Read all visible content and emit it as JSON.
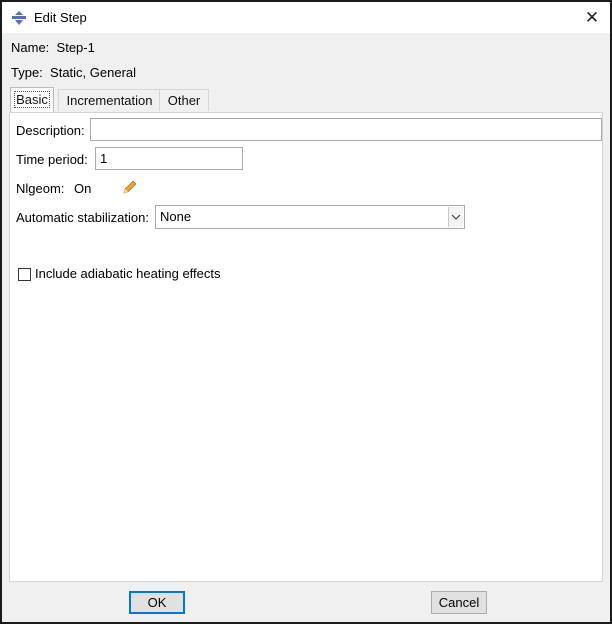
{
  "window": {
    "title": "Edit Step",
    "close_glyph": "✕"
  },
  "step": {
    "name_label": "Name:",
    "name_value": "Step-1",
    "type_label": "Type:",
    "type_value": "Static, General"
  },
  "tabs": [
    {
      "label": "Basic",
      "active": true
    },
    {
      "label": "Incrementation",
      "active": false
    },
    {
      "label": "Other",
      "active": false
    }
  ],
  "basic": {
    "description_label": "Description:",
    "description_value": "",
    "time_period_label": "Time period:",
    "time_period_value": "1",
    "nlgeom_label": "Nlgeom:",
    "nlgeom_value": "On",
    "stabilization_label": "Automatic stabilization:",
    "stabilization_value": "None",
    "adiabatic_label": "Include adiabatic heating effects",
    "adiabatic_checked": false
  },
  "buttons": {
    "ok": "OK",
    "cancel": "Cancel"
  },
  "icons": {
    "app": "abaqus-step-icon",
    "close": "close-icon",
    "edit": "pencil-icon",
    "dropdown": "chevron-down-icon"
  },
  "colors": {
    "default_button_border": "#0078d7",
    "pencil": "#e8a33a"
  }
}
